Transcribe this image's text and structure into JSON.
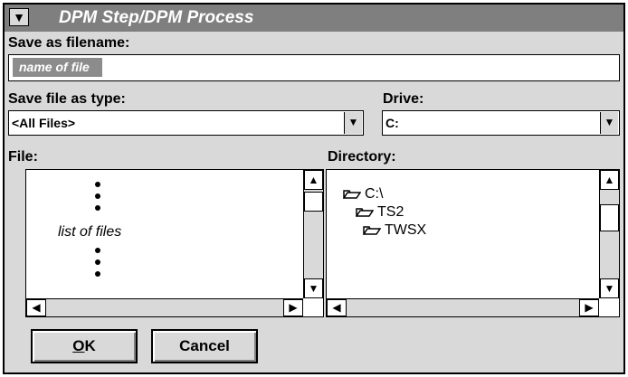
{
  "window": {
    "title": "DPM Step/DPM Process",
    "sysmenu_icon": "down-arrow-icon"
  },
  "save_as": {
    "label": "Save as filename:",
    "placeholder": "name of file"
  },
  "file_type": {
    "label": "Save file as type:",
    "value": "<All Files>"
  },
  "drive": {
    "label": "Drive:",
    "value": "C:"
  },
  "file_list": {
    "label": "File:",
    "note": "list of files"
  },
  "directory": {
    "label": "Directory:",
    "items": [
      "C:\\",
      "TS2",
      "TWSX"
    ]
  },
  "buttons": {
    "ok_mnemonic": "O",
    "ok_rest": "K",
    "cancel": "Cancel"
  }
}
